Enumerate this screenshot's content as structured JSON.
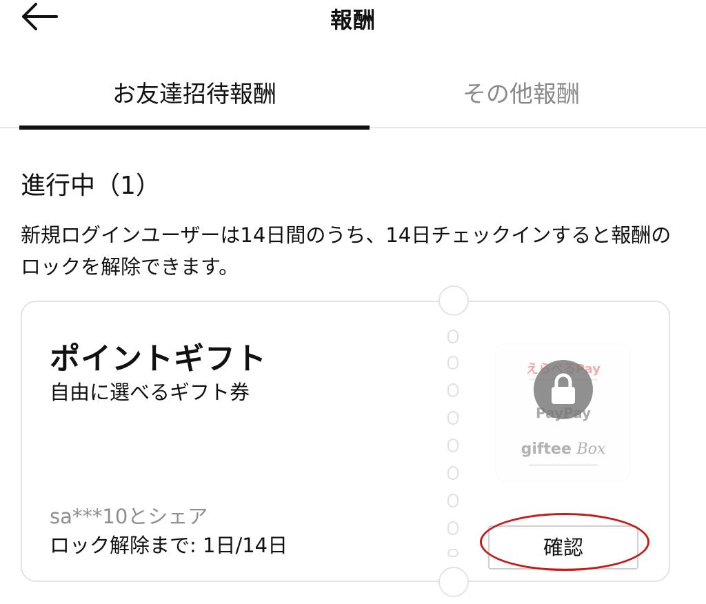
{
  "header": {
    "title": "報酬",
    "back_icon": "arrow-left-icon"
  },
  "tabs": [
    {
      "label": "お友達招待報酬",
      "active": true
    },
    {
      "label": "その他報酬",
      "active": false
    }
  ],
  "section": {
    "title": "進行中（1）",
    "description": "新規ログインユーザーは14日間のうち、14日チェックインすると報酬のロックを解除できます。"
  },
  "reward_card": {
    "title": "ポイントギフト",
    "subtitle": "自由に選べるギフト券",
    "share_text": "sa***10とシェア",
    "unlock_progress": "ロック解除まで: 1日/14日",
    "confirm_label": "確認",
    "lock_icon": "lock-icon",
    "thumbnail_brands": {
      "erabel": "えらべるPay",
      "paypay": "PayPay",
      "giftee": "giftee",
      "giftee_box": "Box"
    }
  },
  "colors": {
    "active_tab": "#111111",
    "inactive_tab": "#8a8a8a",
    "annotation": "#c41b1b"
  }
}
